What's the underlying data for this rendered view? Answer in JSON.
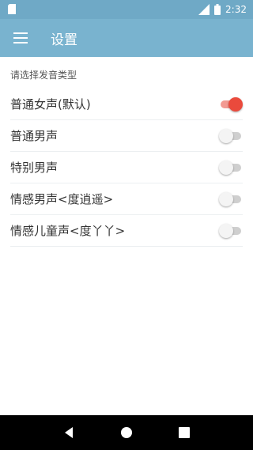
{
  "status_bar": {
    "time": "2:32",
    "icons": [
      "sim-card-icon",
      "signal-icon",
      "battery-icon"
    ]
  },
  "app_bar": {
    "title": "设置",
    "menu_icon": "hamburger-menu-icon"
  },
  "section": {
    "header": "请选择发音类型"
  },
  "voice_options": [
    {
      "label": "普通女声(默认)",
      "checked": true
    },
    {
      "label": "普通男声",
      "checked": false
    },
    {
      "label": "特别男声",
      "checked": false
    },
    {
      "label": "情感男声<度逍遥>",
      "checked": false
    },
    {
      "label": "情感儿童声<度丫丫>",
      "checked": false
    }
  ],
  "nav_bar": {
    "buttons": [
      "back-icon",
      "home-icon",
      "recents-icon"
    ]
  },
  "colors": {
    "status_bar": "#6fa9c6",
    "app_bar": "#79b3cf",
    "switch_on": "#ea4a3c",
    "switch_on_track": "#f29a92"
  }
}
